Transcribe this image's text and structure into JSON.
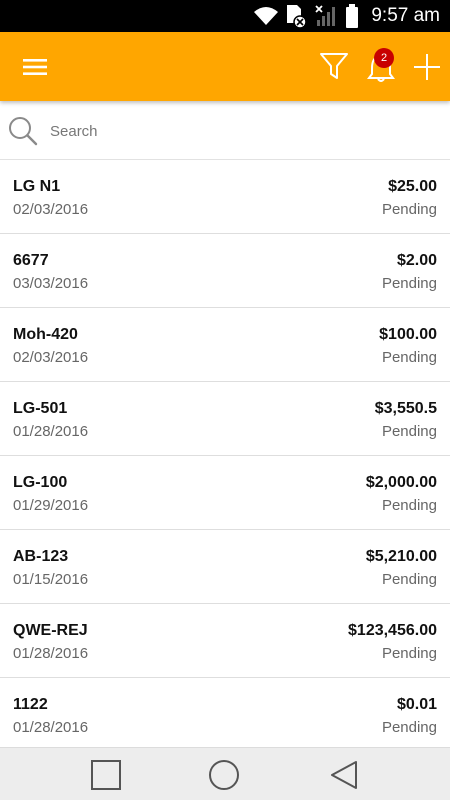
{
  "status_bar": {
    "time": "9:57 am"
  },
  "app_bar": {
    "notification_count": "2",
    "accent_color": "#FFA600"
  },
  "search": {
    "placeholder": "Search"
  },
  "items": [
    {
      "name": "LG N1",
      "date": "02/03/2016",
      "amount": "$25.00",
      "status": "Pending"
    },
    {
      "name": "6677",
      "date": "03/03/2016",
      "amount": "$2.00",
      "status": "Pending"
    },
    {
      "name": "Moh-420",
      "date": "02/03/2016",
      "amount": "$100.00",
      "status": "Pending"
    },
    {
      "name": "LG-501",
      "date": "01/28/2016",
      "amount": "$3,550.5",
      "status": "Pending"
    },
    {
      "name": "LG-100",
      "date": "01/29/2016",
      "amount": "$2,000.00",
      "status": "Pending"
    },
    {
      "name": "AB-123",
      "date": "01/15/2016",
      "amount": "$5,210.00",
      "status": "Pending"
    },
    {
      "name": "QWE-REJ",
      "date": "01/28/2016",
      "amount": "$123,456.00",
      "status": "Pending"
    },
    {
      "name": "1122",
      "date": "01/28/2016",
      "amount": "$0.01",
      "status": "Pending"
    }
  ],
  "icons": {
    "menu": "hamburger-icon",
    "filter": "filter-icon",
    "bell": "bell-icon",
    "add": "plus-icon",
    "search": "magnifier-icon"
  }
}
